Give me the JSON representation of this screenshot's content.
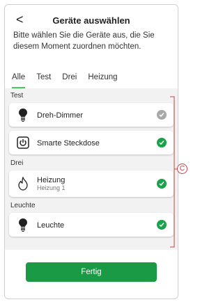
{
  "header": {
    "back": "<",
    "title": "Geräte auswählen",
    "subtitle": "Bitte wählen Sie die Geräte aus, die Sie diesem Moment zuordnen möchten."
  },
  "tabs": [
    "Alle",
    "Test",
    "Drei",
    "Heizung"
  ],
  "sections": [
    {
      "title": "Test",
      "items": [
        {
          "name": "Dreh-Dimmer",
          "selected": false,
          "icon": "bulb-icon"
        },
        {
          "name": "Smarte Steckdose",
          "selected": true,
          "icon": "socket-icon"
        }
      ]
    },
    {
      "title": "Drei",
      "items": [
        {
          "name": "Heizung",
          "sub": "Heizung 1",
          "selected": true,
          "icon": "flame-icon"
        }
      ]
    },
    {
      "title": "Leuchte",
      "items": [
        {
          "name": "Leuchte",
          "selected": true,
          "icon": "bulb-icon"
        }
      ]
    }
  ],
  "footer": {
    "button": "Fertig"
  },
  "callout": "C",
  "colors": {
    "accent": "#1a9a45",
    "check_green": "#1aa34a",
    "check_grey": "#a8a8a8",
    "tab_underline": "#3dcd58",
    "callout": "#c94040"
  }
}
